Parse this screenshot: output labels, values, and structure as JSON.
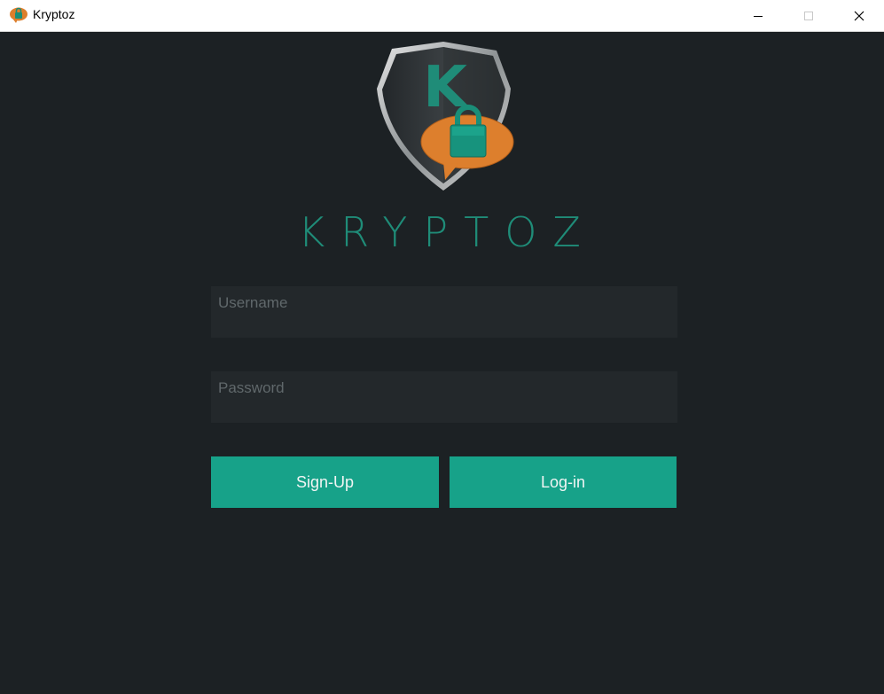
{
  "window": {
    "title": "Kryptoz",
    "controls": [
      "minimize",
      "maximize",
      "close"
    ]
  },
  "logo": {
    "letter": "K",
    "wordmark": "KRYPTOZ",
    "colors": {
      "teal": "#1f8c78",
      "orange": "#dd7f2d",
      "shield": "#2b2f31"
    }
  },
  "form": {
    "username": {
      "placeholder": "Username",
      "value": ""
    },
    "password": {
      "placeholder": "Password",
      "value": ""
    },
    "signup_label": "Sign-Up",
    "login_label": "Log-in"
  },
  "theme": {
    "background": "#1c2124",
    "field_bg": "#23282b",
    "accent": "#17a289"
  }
}
